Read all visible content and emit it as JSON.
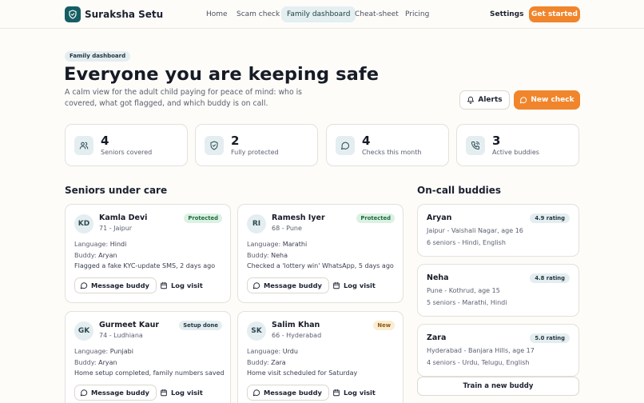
{
  "brand": {
    "name": "Suraksha Setu",
    "icon": "shield-icon"
  },
  "nav": {
    "items": [
      {
        "label": "Home",
        "active": false
      },
      {
        "label": "Scam check",
        "active": false
      },
      {
        "label": "Family dashboard",
        "active": true
      },
      {
        "label": "Cheat-sheet",
        "active": false
      },
      {
        "label": "Pricing",
        "active": false
      }
    ],
    "settings": "Settings",
    "cta": "Get started"
  },
  "hero": {
    "eyebrow": "Family dashboard",
    "title": "Everyone you are keeping safe",
    "subtitle": "A calm view for the adult child paying for peace of mind: who is covered, what got flagged, and which buddy is on call.",
    "alerts_button": "Alerts",
    "new_check_button": "New check"
  },
  "stats": [
    {
      "value": "4",
      "label": "Seniors covered",
      "icon": "people-icon"
    },
    {
      "value": "2",
      "label": "Fully protected",
      "icon": "shield-check-icon"
    },
    {
      "value": "4",
      "label": "Checks this month",
      "icon": "message-icon"
    },
    {
      "value": "3",
      "label": "Active buddies",
      "icon": "phone-icon"
    }
  ],
  "seniors_section": {
    "title": "Seniors under care",
    "label_language": "Language:",
    "label_buddy": "Buddy:",
    "message_button": "Message buddy",
    "log_button": "Log visit",
    "cards": [
      {
        "initials": "KD",
        "name": "Kamla Devi",
        "meta": "71 - Jaipur",
        "status": "Protected",
        "language": "Hindi",
        "buddy": "Aryan",
        "note": "Flagged a fake KYC-update SMS, 2 days ago"
      },
      {
        "initials": "RI",
        "name": "Ramesh Iyer",
        "meta": "68 - Pune",
        "status": "Protected",
        "language": "Marathi",
        "buddy": "Neha",
        "note": "Checked a 'lottery win' WhatsApp, 5 days ago"
      },
      {
        "initials": "GK",
        "name": "Gurmeet Kaur",
        "meta": "74 - Ludhiana",
        "status": "Setup done",
        "language": "Punjabi",
        "buddy": "Aryan",
        "note": "Home setup completed, family numbers saved"
      },
      {
        "initials": "SK",
        "name": "Salim Khan",
        "meta": "66 - Hyderabad",
        "status": "New",
        "language": "Urdu",
        "buddy": "Zara",
        "note": "Home visit scheduled for Saturday"
      }
    ]
  },
  "status_colors": {
    "Protected": {
      "bg": "#dcf1e3",
      "fg": "#1d6b3e"
    },
    "Setup done": {
      "bg": "#e4eef0",
      "fg": "#233640"
    },
    "New": {
      "bg": "#fbedd2",
      "fg": "#8a5a12"
    }
  },
  "buddies_section": {
    "title": "On-call buddies",
    "cards": [
      {
        "name": "Aryan",
        "rating": "4.9 rating",
        "location": "Jaipur - Vaishali Nagar, age 16",
        "languages": "6 seniors - Hindi, English"
      },
      {
        "name": "Neha",
        "rating": "4.8 rating",
        "location": "Pune - Kothrud, age 15",
        "languages": "5 seniors - Marathi, Hindi"
      },
      {
        "name": "Zara",
        "rating": "5.0 rating",
        "location": "Hyderabad - Banjara Hills, age 17",
        "languages": "4 seniors - Urdu, Telugu, English"
      }
    ],
    "train_button": "Train a new buddy"
  },
  "colors": {
    "accent": "#f0852c",
    "brand": "#155e63",
    "tint": "#e4eef0"
  }
}
